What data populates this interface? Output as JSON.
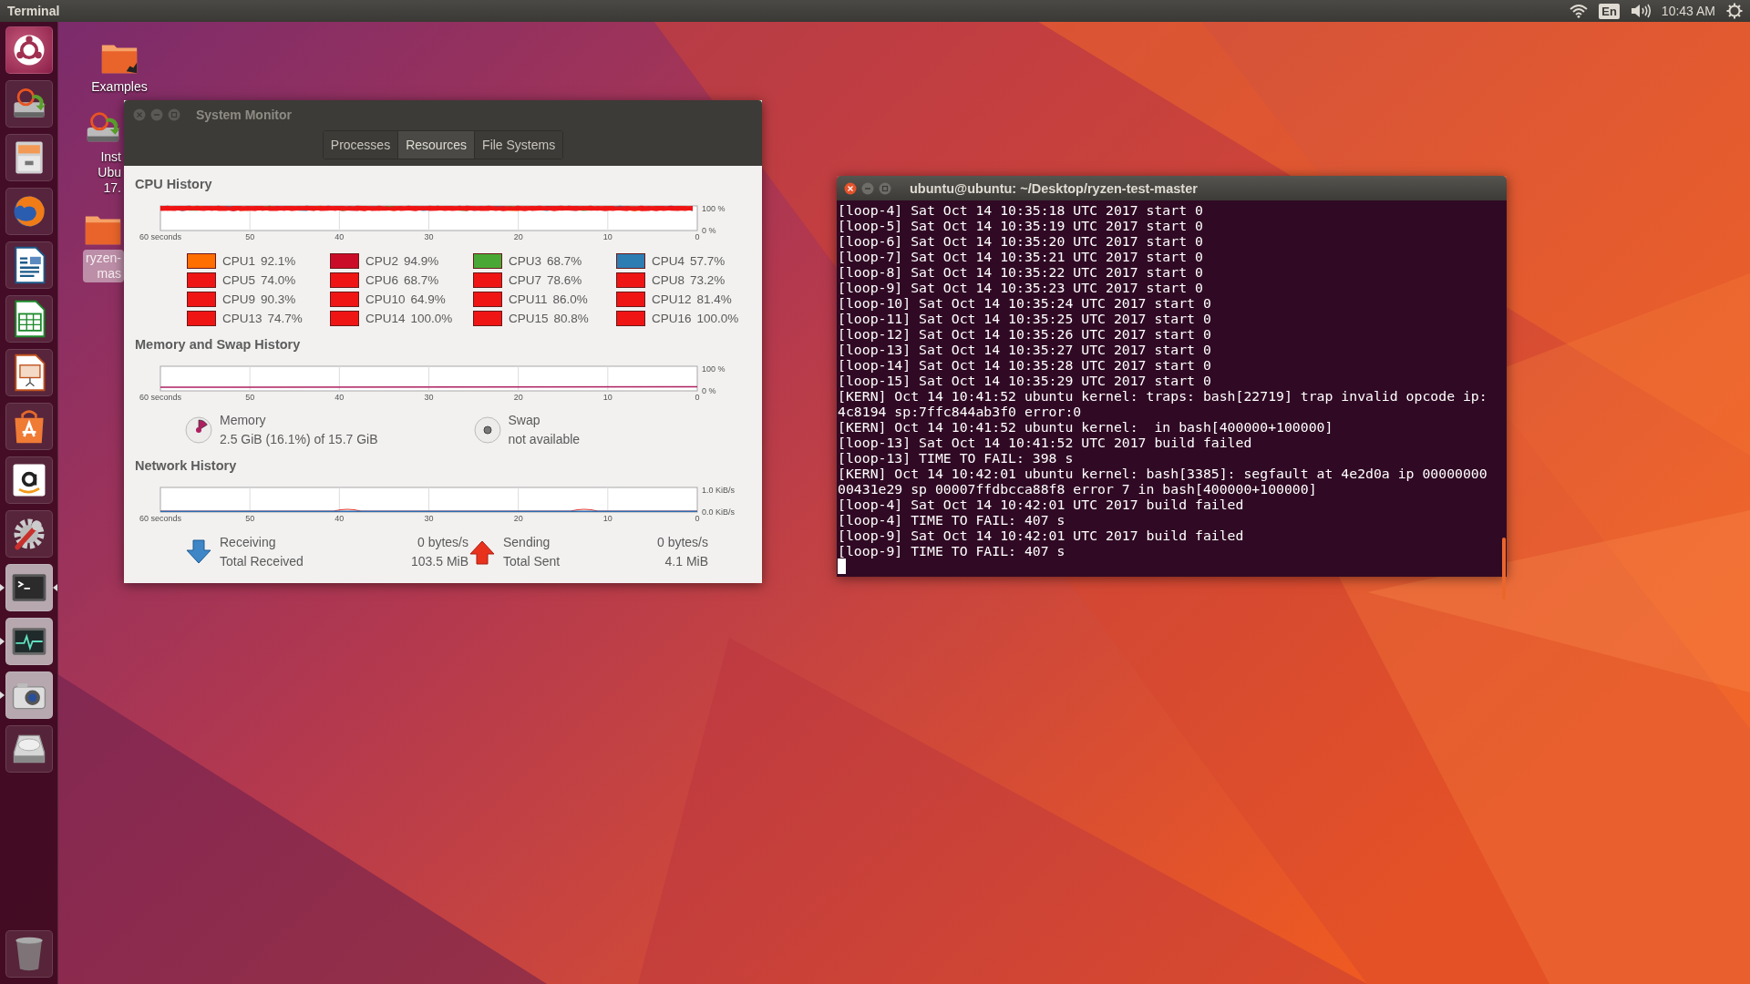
{
  "top_bar": {
    "app_title": "Terminal",
    "keyboard_layout": "En",
    "clock": "10:43 AM"
  },
  "launcher": {
    "items": [
      {
        "kind": "dash",
        "running": false,
        "focused": false
      },
      {
        "kind": "installer",
        "running": false,
        "focused": false
      },
      {
        "kind": "files",
        "running": false,
        "focused": false
      },
      {
        "kind": "browser",
        "running": false,
        "focused": false
      },
      {
        "kind": "writer",
        "running": false,
        "focused": false
      },
      {
        "kind": "calc",
        "running": false,
        "focused": false
      },
      {
        "kind": "impress",
        "running": false,
        "focused": false
      },
      {
        "kind": "store",
        "running": false,
        "focused": false
      },
      {
        "kind": "shop",
        "running": false,
        "focused": false
      },
      {
        "kind": "settings",
        "running": false,
        "focused": false
      },
      {
        "kind": "terminal",
        "running": true,
        "focused": true
      },
      {
        "kind": "monitor",
        "running": true,
        "focused": false
      },
      {
        "kind": "camera",
        "running": true,
        "focused": false
      },
      {
        "kind": "disk",
        "running": false,
        "focused": false
      }
    ]
  },
  "desktop_icons": [
    {
      "kind": "folder-link",
      "label_lines": [
        "Examples"
      ],
      "selected": false
    },
    {
      "kind": "installer",
      "label_lines": [
        "Inst",
        "Ubu",
        "17."
      ],
      "selected": false
    },
    {
      "kind": "folder",
      "label_lines": [
        "ryzen-",
        "mas"
      ],
      "selected": true
    }
  ],
  "system_monitor": {
    "title": "System Monitor",
    "tabs": [
      {
        "label": "Processes",
        "selected": false
      },
      {
        "label": "Resources",
        "selected": true
      },
      {
        "label": "File Systems",
        "selected": false
      }
    ],
    "cpu": {
      "heading": "CPU History",
      "x_labels": [
        "60 seconds",
        "50",
        "40",
        "30",
        "20",
        "10",
        "0"
      ],
      "y_labels": [
        "100 %",
        "0 %"
      ],
      "legend": [
        {
          "name": "CPU1",
          "value": "92.1%",
          "color": "#ff6e00"
        },
        {
          "name": "CPU2",
          "value": "94.9%",
          "color": "#cb0c29"
        },
        {
          "name": "CPU3",
          "value": "68.7%",
          "color": "#49a835"
        },
        {
          "name": "CPU4",
          "value": "57.7%",
          "color": "#2d7db3"
        },
        {
          "name": "CPU5",
          "value": "74.0%",
          "color": "#ef1515"
        },
        {
          "name": "CPU6",
          "value": "68.7%",
          "color": "#ef1515"
        },
        {
          "name": "CPU7",
          "value": "78.6%",
          "color": "#ef1515"
        },
        {
          "name": "CPU8",
          "value": "73.2%",
          "color": "#ef1515"
        },
        {
          "name": "CPU9",
          "value": "90.3%",
          "color": "#ef1515"
        },
        {
          "name": "CPU10",
          "value": "64.9%",
          "color": "#ef1515"
        },
        {
          "name": "CPU11",
          "value": "86.0%",
          "color": "#ef1515"
        },
        {
          "name": "CPU12",
          "value": "81.4%",
          "color": "#ef1515"
        },
        {
          "name": "CPU13",
          "value": "74.7%",
          "color": "#ef1515"
        },
        {
          "name": "CPU14",
          "value": "100.0%",
          "color": "#ef1515"
        },
        {
          "name": "CPU15",
          "value": "80.8%",
          "color": "#ef1515"
        },
        {
          "name": "CPU16",
          "value": "100.0%",
          "color": "#ef1515"
        }
      ]
    },
    "memory": {
      "heading": "Memory and Swap History",
      "x_labels": [
        "60 seconds",
        "50",
        "40",
        "30",
        "20",
        "10",
        "0"
      ],
      "y_labels": [
        "100 %",
        "0 %"
      ],
      "memory": {
        "label": "Memory",
        "value": "2.5 GiB (16.1%) of 15.7 GiB",
        "level": 0.161
      },
      "swap": {
        "label": "Swap",
        "value": "not available"
      }
    },
    "network": {
      "heading": "Network History",
      "x_labels": [
        "60 seconds",
        "50",
        "40",
        "30",
        "20",
        "10",
        "0"
      ],
      "y_labels": [
        "1.0 KiB/s",
        "0.0 KiB/s"
      ],
      "receiving": {
        "label": "Receiving",
        "rate": "0 bytes/s",
        "total_label": "Total Received",
        "total": "103.5 MiB"
      },
      "sending": {
        "label": "Sending",
        "rate": "0 bytes/s",
        "total_label": "Total Sent",
        "total": "4.1 MiB"
      }
    }
  },
  "terminal": {
    "title": "ubuntu@ubuntu: ~/Desktop/ryzen-test-master",
    "lines": [
      "[loop-4] Sat Oct 14 10:35:18 UTC 2017 start 0",
      "[loop-5] Sat Oct 14 10:35:19 UTC 2017 start 0",
      "[loop-6] Sat Oct 14 10:35:20 UTC 2017 start 0",
      "[loop-7] Sat Oct 14 10:35:21 UTC 2017 start 0",
      "[loop-8] Sat Oct 14 10:35:22 UTC 2017 start 0",
      "[loop-9] Sat Oct 14 10:35:23 UTC 2017 start 0",
      "[loop-10] Sat Oct 14 10:35:24 UTC 2017 start 0",
      "[loop-11] Sat Oct 14 10:35:25 UTC 2017 start 0",
      "[loop-12] Sat Oct 14 10:35:26 UTC 2017 start 0",
      "[loop-13] Sat Oct 14 10:35:27 UTC 2017 start 0",
      "[loop-14] Sat Oct 14 10:35:28 UTC 2017 start 0",
      "[loop-15] Sat Oct 14 10:35:29 UTC 2017 start 0",
      "[KERN] Oct 14 10:41:52 ubuntu kernel: traps: bash[22719] trap invalid opcode ip:",
      "4c8194 sp:7ffc844ab3f0 error:0",
      "[KERN] Oct 14 10:41:52 ubuntu kernel:  in bash[400000+100000]",
      "[loop-13] Sat Oct 14 10:41:52 UTC 2017 build failed",
      "[loop-13] TIME TO FAIL: 398 s",
      "[KERN] Oct 14 10:42:01 ubuntu kernel: bash[3385]: segfault at 4e2d0a ip 00000000",
      "00431e29 sp 00007ffdbcca88f8 error 7 in bash[400000+100000]",
      "[loop-4] Sat Oct 14 10:42:01 UTC 2017 build failed",
      "[loop-4] TIME TO FAIL: 407 s",
      "[loop-9] Sat Oct 14 10:42:01 UTC 2017 build failed",
      "[loop-9] TIME TO FAIL: 407 s"
    ]
  }
}
